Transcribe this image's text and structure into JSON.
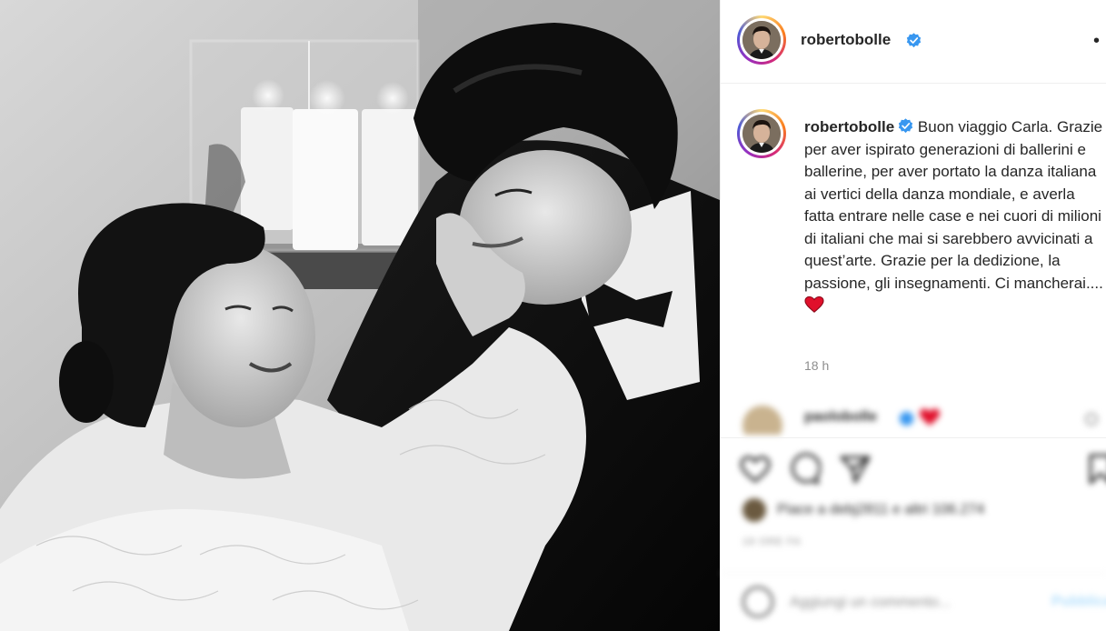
{
  "post": {
    "username": "robertobolle",
    "more_label": "•",
    "caption_text": "Buon viaggio Carla. Grazie per aver ispirato generazioni di ballerini e ballerine, per aver portato la danza italiana ai vertici della danza mondiale, e averla fatta entrare nelle case e nei cuori di milioni di italiani che mai si sarebbero avvicinati a quest’arte. Grazie per la dedizione, la passione, gli insegnamenti. Ci mancherai....",
    "time_ago": "18 h"
  },
  "comments": [
    {
      "username": "paolobolle"
    }
  ],
  "likes": {
    "text": "Piace a debj2811 e altri 106.274"
  },
  "post_date": "18 ORE FA",
  "add_comment": {
    "placeholder": "Aggiungi un commento...",
    "publish_label": "Pubblica"
  },
  "icons": {
    "verified": "verified-badge-icon",
    "heart_emoji": "red-heart-emoji-icon",
    "like": "heart-outline-icon",
    "comment": "comment-bubble-icon",
    "share": "paper-plane-icon",
    "save": "bookmark-icon",
    "emoji": "smiley-icon"
  },
  "colors": {
    "verified_blue": "#3897f0",
    "heart_red": "#e0102b",
    "text": "#262626",
    "secondary": "#8e8e8e",
    "publish": "#b2dffc"
  }
}
